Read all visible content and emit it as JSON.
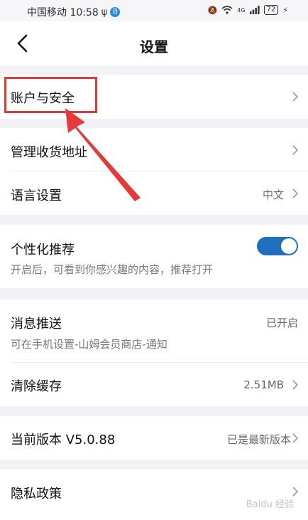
{
  "status_bar": {
    "carrier_time": "中国移动 10:58",
    "signal": "4G",
    "battery": "72"
  },
  "header": {
    "title": "设置"
  },
  "settings": {
    "account_security": "账户与安全",
    "shipping_address": "管理收货地址",
    "language": {
      "label": "语言设置",
      "value": "中文"
    },
    "personalized": {
      "label": "个性化推荐",
      "description": "开启后，可看到你感兴趣的内容，推荐打开",
      "enabled": true
    },
    "push": {
      "label": "消息推送",
      "value": "已开启",
      "description": "可在手机设置-山姆会员商店-通知"
    },
    "cache": {
      "label": "清除缓存",
      "value": "2.51MB"
    },
    "version": {
      "label": "当前版本 V5.0.88",
      "value": "已是最新版本"
    },
    "privacy": "隐私政策"
  },
  "watermark": "Baidu 经验",
  "colors": {
    "accent": "#1e6fbf",
    "highlight": "#e23a3a",
    "background": "#f2f2f6"
  }
}
